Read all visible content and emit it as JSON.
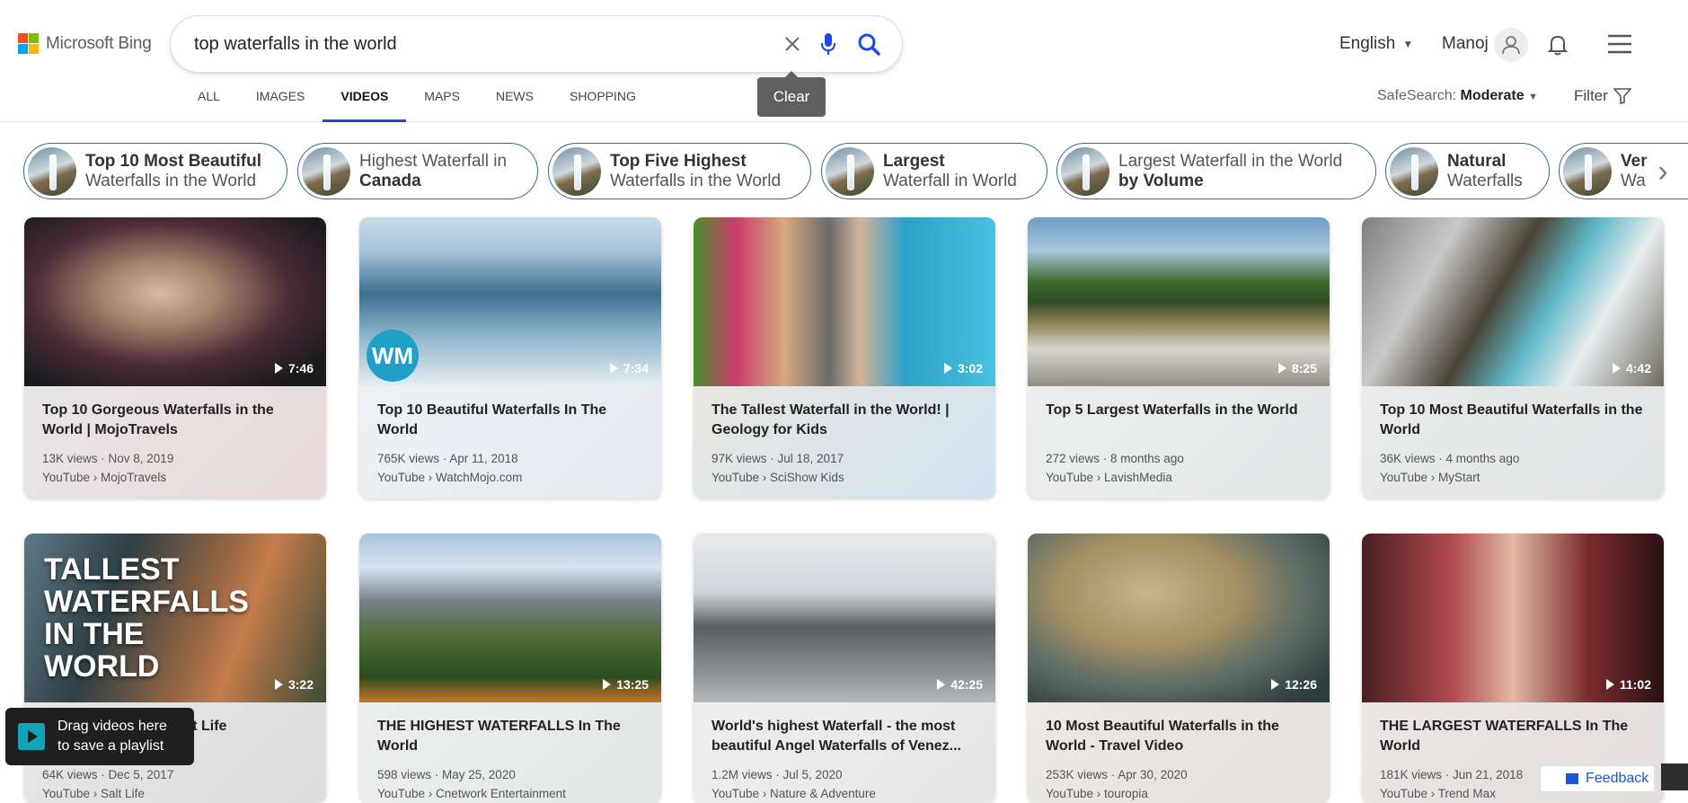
{
  "brand": {
    "logo_text": "Microsoft Bing",
    "colors": [
      "#f25022",
      "#7fba00",
      "#00a4ef",
      "#ffb900"
    ]
  },
  "search": {
    "query": "top waterfalls in the world",
    "clear_tooltip": "Clear"
  },
  "tabs": [
    "ALL",
    "IMAGES",
    "VIDEOS",
    "MAPS",
    "NEWS",
    "SHOPPING"
  ],
  "active_tab": "VIDEOS",
  "top_right": {
    "language": "English",
    "user": "Manoj"
  },
  "safesearch": {
    "label": "SafeSearch:",
    "value": "Moderate"
  },
  "filter_label": "Filter",
  "chips": [
    {
      "line1": "Top 10 Most Beautiful",
      "line2": "Waterfalls in the World"
    },
    {
      "line1": "Highest Waterfall in",
      "line2": "Canada"
    },
    {
      "line1": "Top Five Highest",
      "line2": "Waterfalls in the World"
    },
    {
      "line1": "Largest",
      "line2": "Waterfall in World"
    },
    {
      "line1": "Largest Waterfall in the World",
      "line2": "by Volume"
    },
    {
      "line1": "Natural",
      "line2": "Waterfalls"
    },
    {
      "line1": "Ver",
      "line2": "Wa"
    }
  ],
  "videos": [
    {
      "title": "Top 10 Gorgeous Waterfalls in the World | MojoTravels",
      "views": "13K views · Nov 8, 2019",
      "source": "YouTube › MojoTravels",
      "duration": "7:46"
    },
    {
      "title": "Top 10 Beautiful Waterfalls In The World",
      "views": "765K views · Apr 11, 2018",
      "source": "YouTube › WatchMojo.com",
      "duration": "7:34"
    },
    {
      "title": "The Tallest Waterfall in the World! | Geology for Kids",
      "views": "97K views · Jul 18, 2017",
      "source": "YouTube › SciShow Kids",
      "duration": "3:02"
    },
    {
      "title": "Top 5 Largest Waterfalls in the World",
      "views": "272 views · 8 months ago",
      "source": "YouTube › LavishMedia",
      "duration": "8:25"
    },
    {
      "title": "Top 10 Most Beautiful Waterfalls in the World",
      "views": "36K views · 4 months ago",
      "source": "YouTube › MyStart",
      "duration": "4:42"
    },
    {
      "title": "Tallest Waterfalls | Salt Life",
      "views": "64K views · Dec 5, 2017",
      "source": "YouTube › Salt Life",
      "duration": "3:22"
    },
    {
      "title": "THE HIGHEST WATERFALLS In The World",
      "views": "598 views · May 25, 2020",
      "source": "YouTube › Cnetwork Entertainment",
      "duration": "13:25"
    },
    {
      "title": "World's highest Waterfall - the most beautiful Angel Waterfalls of Venez...",
      "views": "1.2M views · Jul 5, 2020",
      "source": "YouTube › Nature & Adventure",
      "duration": "42:25"
    },
    {
      "title": "10 Most Beautiful Waterfalls in the World - Travel Video",
      "views": "253K views · Apr 30, 2020",
      "source": "YouTube › touropia",
      "duration": "12:26"
    },
    {
      "title": "THE LARGEST WATERFALLS In The World",
      "views": "181K views · Jun 21, 2018",
      "source": "YouTube › Trend Max",
      "duration": "11:02"
    }
  ],
  "drag_toast": {
    "line1": "Drag videos here",
    "line2": "to save a playlist"
  },
  "feedback_label": "Feedback"
}
